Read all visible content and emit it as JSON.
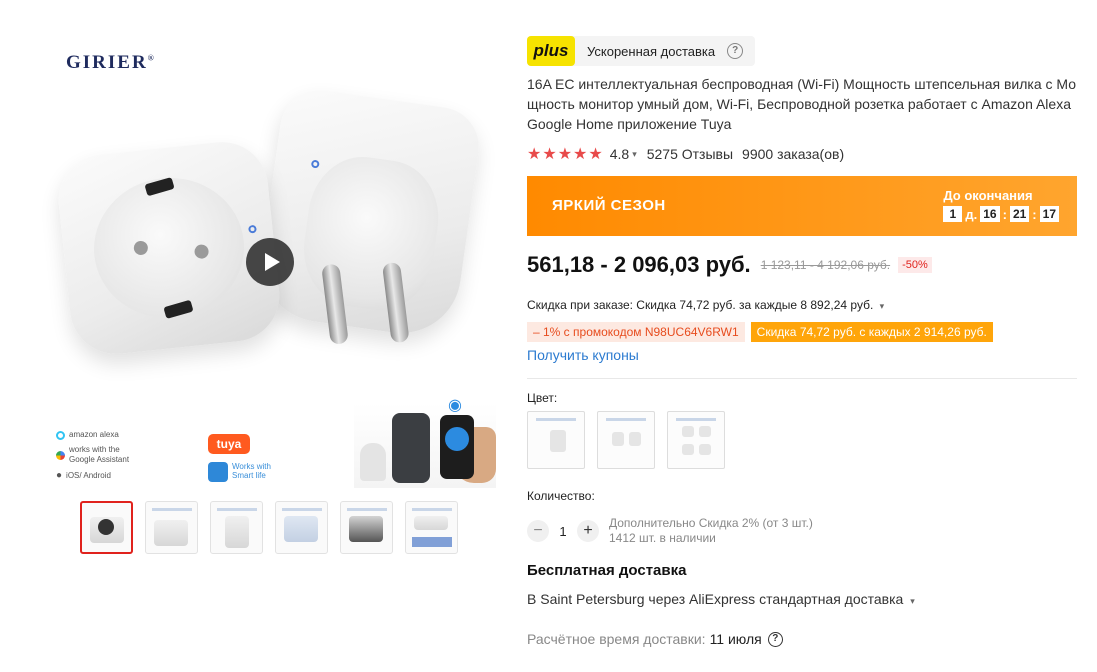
{
  "gallery": {
    "brand": "GIRIER",
    "brand_mark": "®",
    "assistants": {
      "alexa": "amazon alexa",
      "google": "works with the Google Assistant",
      "os": "iOS/ Android"
    },
    "tuya": "tuya",
    "smart_life": "Works with Smart life"
  },
  "delivery_badge": {
    "logo": "plus",
    "label": "Ускоренная доставка",
    "help": "?"
  },
  "product": {
    "title": "16A EC интеллектуальная беспроводная (Wi-Fi) Мощность штепсельная вилка с Мощность монитор умный дом, Wi-Fi, Беспроводной розетка работает с Amazon Alexa Google Home приложение Tuya",
    "stars": "★★★★★",
    "rating": "4.8",
    "reviews": "5275 Отзывы",
    "orders": "9900 заказа(ов)"
  },
  "promo_banner": {
    "title": "ЯРКИЙ СЕЗОН",
    "countdown_label": "До окончания",
    "days": "1",
    "days_unit": "д.",
    "hours": "16",
    "minutes": "21",
    "seconds": "17"
  },
  "pricing": {
    "price": "561,18 - 2 096,03 руб.",
    "old_price": "1 123,11 - 4 192,06 руб.",
    "discount": "-50%",
    "order_discount": "Скидка при заказе: Скидка 74,72 руб. за каждые 8 892,24 руб.",
    "promo_code": "– 1% с промокодом N98UC64V6RW1",
    "promo_store": "Скидка 74,72 руб. с каждых 2 914,26 руб.",
    "coupons_link": "Получить купоны"
  },
  "options": {
    "color_label": "Цвет:",
    "quantity_label": "Количество:",
    "quantity": "1",
    "minus": "−",
    "plus": "+",
    "bulk_discount": "Дополнительно Скидка 2% (от 3 шт.)",
    "stock": "1412 шт. в наличии"
  },
  "shipping": {
    "title": "Бесплатная доставка",
    "route": "В Saint Petersburg через AliExpress стандартная доставка",
    "time_label": "Расчётное время доставки:",
    "time_value": "11 июля",
    "help": "?"
  }
}
